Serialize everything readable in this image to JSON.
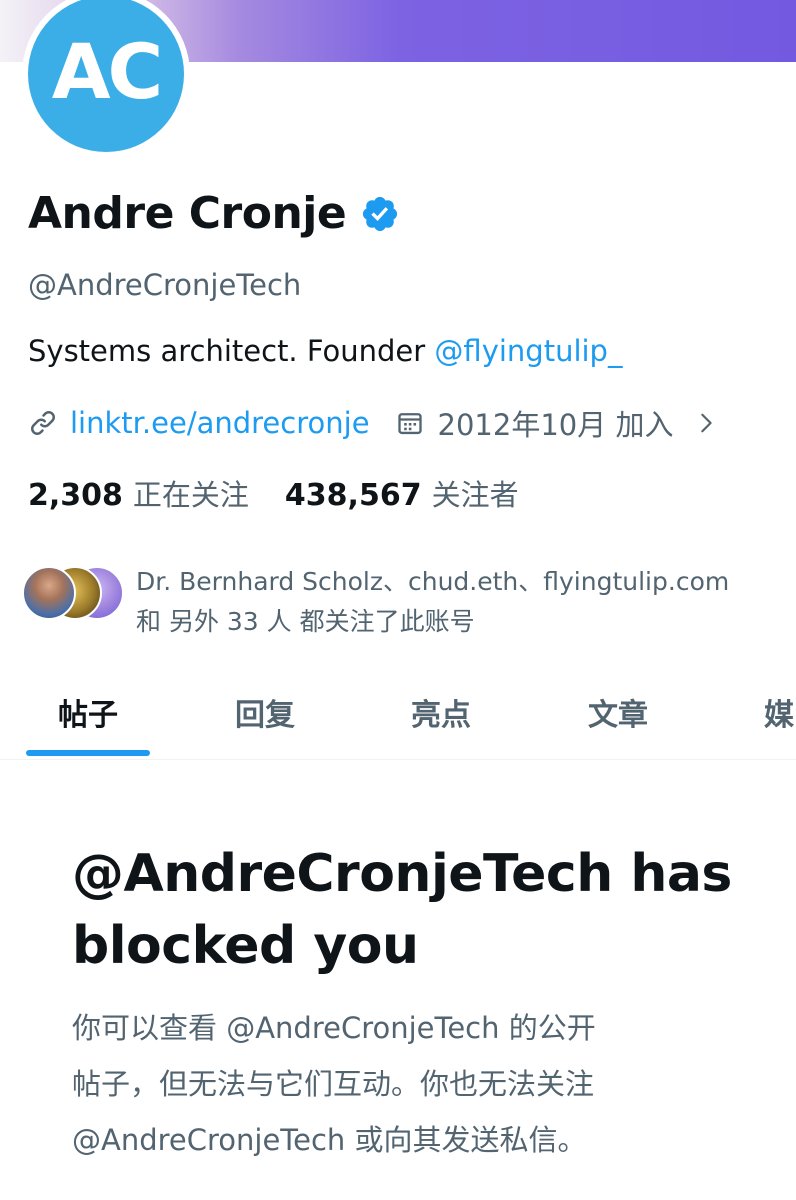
{
  "profile": {
    "avatar_text": "AC",
    "name": "Andre Cronje",
    "handle": "@AndreCronjeTech",
    "bio_text": "Systems architect. Founder ",
    "bio_mention": "@flyingtulip_",
    "link": "linktr.ee/andrecronje",
    "joined": "2012年10月 加入"
  },
  "stats": {
    "following_count": "2,308",
    "following_label": "正在关注",
    "followers_count": "438,567",
    "followers_label": "关注者"
  },
  "known_followers": {
    "line1": "Dr. Bernhard Scholz、chud.eth、flyingtulip.com",
    "line2": "和 另外 33 人 都关注了此账号"
  },
  "tabs": [
    {
      "label": "帖子"
    },
    {
      "label": "回复"
    },
    {
      "label": "亮点"
    },
    {
      "label": "文章"
    },
    {
      "label": "媒"
    }
  ],
  "blocked": {
    "title_line1": "@AndreCronjeTech has",
    "title_line2": "blocked you",
    "desc_line1": "你可以查看 @AndreCronjeTech 的公开",
    "desc_line2": "帖子，但无法与它们互动。你也无法关注",
    "desc_line3": "@AndreCronjeTech 或向其发送私信。"
  },
  "colors": {
    "accent": "#1d9bf0",
    "avatar_bg": "#3baee8",
    "secondary_text": "#536471"
  },
  "icons": {
    "verified": "verified-badge-icon",
    "link": "link-icon",
    "calendar": "calendar-icon",
    "chevron": "chevron-right-icon"
  }
}
